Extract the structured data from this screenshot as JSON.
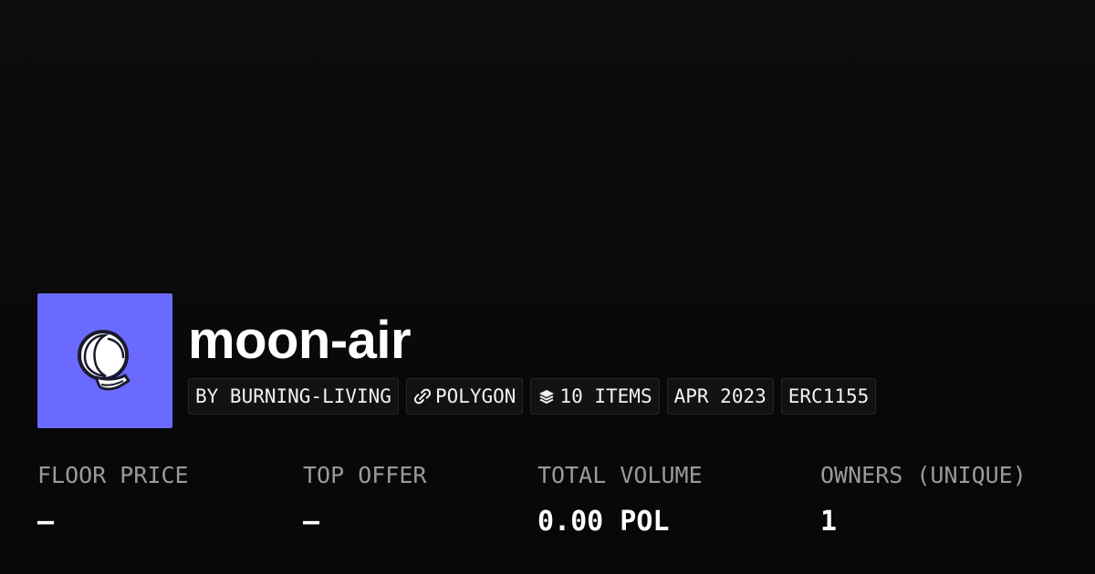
{
  "collection": {
    "name": "moon-air",
    "icon": "astronaut-helmet-icon",
    "accent_color": "#6b6afe"
  },
  "chips": {
    "creator": "BY BURNING-LIVING",
    "chain": "POLYGON",
    "chain_icon": "polygon-link-icon",
    "items": "10 ITEMS",
    "items_icon": "layers-stack-icon",
    "date": "APR 2023",
    "standard": "ERC1155"
  },
  "stats": {
    "floor_price": {
      "label": "FLOOR PRICE",
      "value": "–"
    },
    "top_offer": {
      "label": "TOP OFFER",
      "value": "–"
    },
    "total_volume": {
      "label": "TOTAL VOLUME",
      "value": "0.00 POL"
    },
    "owners": {
      "label": "OWNERS (UNIQUE)",
      "value": "1"
    }
  }
}
